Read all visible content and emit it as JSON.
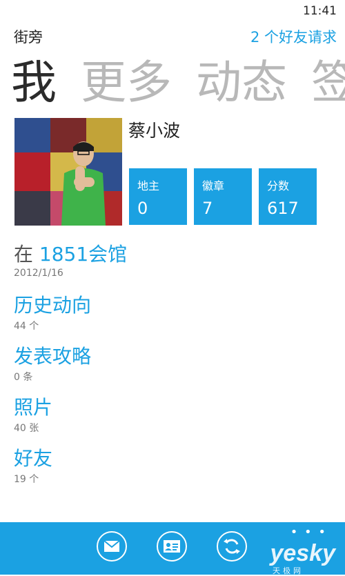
{
  "status": {
    "time": "11:41"
  },
  "header": {
    "app_title": "街旁",
    "friend_requests": "2 个好友请求"
  },
  "pivot": {
    "items": [
      "我",
      "更多",
      "动态",
      "签"
    ]
  },
  "profile": {
    "name": "蔡小波"
  },
  "tiles": [
    {
      "label": "地主",
      "value": "0"
    },
    {
      "label": "徽章",
      "value": "7"
    },
    {
      "label": "分数",
      "value": "617"
    }
  ],
  "checkin": {
    "prefix": "在",
    "place": "1851会馆",
    "date": "2012/1/16"
  },
  "list": [
    {
      "title": "历史动向",
      "sub": "44 个"
    },
    {
      "title": "发表攻略",
      "sub": "0 条"
    },
    {
      "title": "照片",
      "sub": "40 张"
    },
    {
      "title": "好友",
      "sub": "19 个"
    }
  ],
  "appbar": {
    "buttons": [
      "mail-icon",
      "contact-card-icon",
      "refresh-icon"
    ],
    "more": "• • •",
    "watermark": "yesky",
    "watermark_sub": "天极网"
  },
  "colors": {
    "accent": "#1ba1e2",
    "pivot_inactive": "#b8b8b8",
    "text": "#222222"
  }
}
